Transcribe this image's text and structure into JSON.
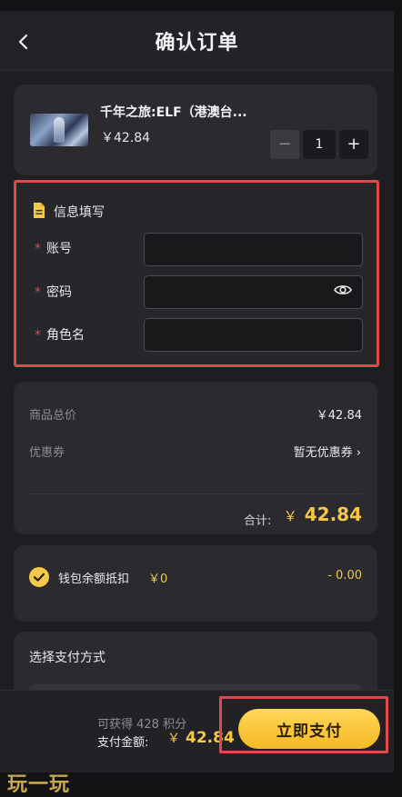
{
  "header": {
    "title": "确认订单"
  },
  "product": {
    "name": "千年之旅:ELF（港澳台...",
    "price": "￥42.84",
    "quantity": "1",
    "minus": "−",
    "plus": "+"
  },
  "info_form": {
    "title": "信息填写",
    "required_mark": "*",
    "fields": [
      {
        "label": "账号",
        "value": ""
      },
      {
        "label": "密码",
        "value": ""
      },
      {
        "label": "角色名",
        "value": ""
      }
    ]
  },
  "summary": {
    "subtotal_label": "商品总价",
    "subtotal_value": "￥42.84",
    "coupon_label": "优惠券",
    "coupon_value": "暂无优惠券 ›",
    "total_label": "合计:",
    "total_currency": "￥",
    "total_value": "42.84"
  },
  "wallet": {
    "label": "钱包余额抵扣",
    "balance": "￥0",
    "deduction": "- 0.00",
    "checked": true
  },
  "payment": {
    "title": "选择支付方式"
  },
  "bottom": {
    "points": "可获得 428 积分",
    "amount_label": "支付金额:",
    "amount_currency": "￥",
    "amount_value": "42.84",
    "pay_button": "立即支付"
  },
  "watermark": "玩一玩",
  "colors": {
    "accent": "#f6c84a",
    "highlight": "#e0494c",
    "background": "#1e1e22"
  },
  "icons": [
    "back-arrow-icon",
    "document-icon",
    "eye-icon",
    "check-circle-icon"
  ]
}
